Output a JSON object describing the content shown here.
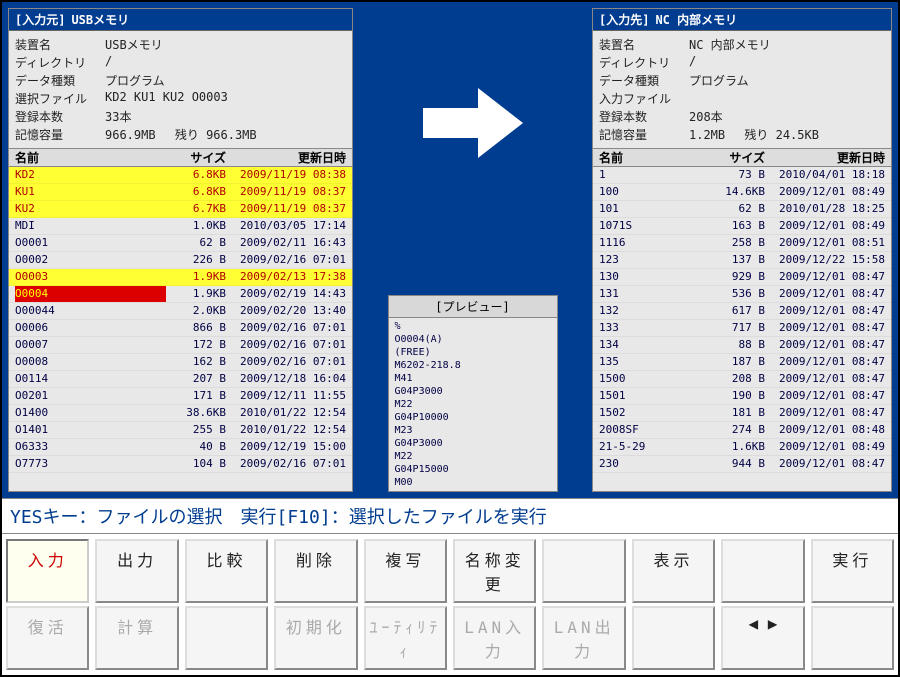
{
  "left": {
    "title_bracket": "[入力元]",
    "title_label": "USBメモリ",
    "meta": {
      "device_key": "装置名",
      "device_val": "USBメモリ",
      "dir_key": "ディレクトリ",
      "dir_val": "/",
      "type_key": "データ種類",
      "type_val": "プログラム",
      "selfile_key": "選択ファイル",
      "selfile_val": "KD2 KU1 KU2 O0003",
      "count_key": "登録本数",
      "count_val": "33本",
      "cap_key": "記憶容量",
      "cap_val": "966.9MB",
      "rem_key": "残り",
      "rem_val": "966.3MB"
    },
    "cols": {
      "name": "名前",
      "size": "サイズ",
      "date": "更新日時"
    },
    "rows": [
      {
        "name": "KD2",
        "size": "6.8KB",
        "date": "2009/11/19 08:38",
        "sel": "y"
      },
      {
        "name": "KU1",
        "size": "6.8KB",
        "date": "2009/11/19 08:37",
        "sel": "y"
      },
      {
        "name": "KU2",
        "size": "6.7KB",
        "date": "2009/11/19 08:37",
        "sel": "y"
      },
      {
        "name": "MDI",
        "size": "1.0KB",
        "date": "2010/03/05 17:14",
        "sel": ""
      },
      {
        "name": "O0001",
        "size": "62 B",
        "date": "2009/02/11 16:43",
        "sel": ""
      },
      {
        "name": "O0002",
        "size": "226 B",
        "date": "2009/02/16 07:01",
        "sel": ""
      },
      {
        "name": "O0003",
        "size": "1.9KB",
        "date": "2009/02/13 17:38",
        "sel": "y"
      },
      {
        "name": "O0004",
        "size": "1.9KB",
        "date": "2009/02/19 14:43",
        "sel": "r"
      },
      {
        "name": "O00044",
        "size": "2.0KB",
        "date": "2009/02/20 13:40",
        "sel": ""
      },
      {
        "name": "O0006",
        "size": "866 B",
        "date": "2009/02/16 07:01",
        "sel": ""
      },
      {
        "name": "O0007",
        "size": "172 B",
        "date": "2009/02/16 07:01",
        "sel": ""
      },
      {
        "name": "O0008",
        "size": "162 B",
        "date": "2009/02/16 07:01",
        "sel": ""
      },
      {
        "name": "O0114",
        "size": "207 B",
        "date": "2009/12/18 16:04",
        "sel": ""
      },
      {
        "name": "O0201",
        "size": "171 B",
        "date": "2009/12/11 11:55",
        "sel": ""
      },
      {
        "name": "O1400",
        "size": "38.6KB",
        "date": "2010/01/22 12:54",
        "sel": ""
      },
      {
        "name": "O1401",
        "size": "255 B",
        "date": "2010/01/22 12:54",
        "sel": ""
      },
      {
        "name": "O6333",
        "size": "40 B",
        "date": "2009/12/19 15:00",
        "sel": ""
      },
      {
        "name": "O7773",
        "size": "104 B",
        "date": "2009/02/16 07:01",
        "sel": ""
      }
    ]
  },
  "preview": {
    "title": "[プレビュー]",
    "lines": [
      "%",
      "O0004(A)",
      "(FREE)",
      "M6202-218.8",
      "M41",
      "G04P3000",
      "M22",
      "G04P10000",
      "M23",
      "G04P3000",
      "M22",
      "G04P15000",
      "M00"
    ]
  },
  "right": {
    "title_bracket": "[入力先]",
    "title_label": "NC 内部メモリ",
    "meta": {
      "device_key": "装置名",
      "device_val": "NC 内部メモリ",
      "dir_key": "ディレクトリ",
      "dir_val": "/",
      "type_key": "データ種類",
      "type_val": "プログラム",
      "infile_key": "入力ファイル",
      "infile_val": "",
      "count_key": "登録本数",
      "count_val": "208本",
      "cap_key": "記憶容量",
      "cap_val": "1.2MB",
      "rem_key": "残り",
      "rem_val": "24.5KB"
    },
    "cols": {
      "name": "名前",
      "size": "サイズ",
      "date": "更新日時"
    },
    "rows": [
      {
        "name": "1",
        "size": "73 B",
        "date": "2010/04/01 18:18"
      },
      {
        "name": "100",
        "size": "14.6KB",
        "date": "2009/12/01 08:49"
      },
      {
        "name": "101",
        "size": "62 B",
        "date": "2010/01/28 18:25"
      },
      {
        "name": "1071S",
        "size": "163 B",
        "date": "2009/12/01 08:49"
      },
      {
        "name": "1116",
        "size": "258 B",
        "date": "2009/12/01 08:51"
      },
      {
        "name": "123",
        "size": "137 B",
        "date": "2009/12/22 15:58"
      },
      {
        "name": "130",
        "size": "929 B",
        "date": "2009/12/01 08:47"
      },
      {
        "name": "131",
        "size": "536 B",
        "date": "2009/12/01 08:47"
      },
      {
        "name": "132",
        "size": "617 B",
        "date": "2009/12/01 08:47"
      },
      {
        "name": "133",
        "size": "717 B",
        "date": "2009/12/01 08:47"
      },
      {
        "name": "134",
        "size": "88 B",
        "date": "2009/12/01 08:47"
      },
      {
        "name": "135",
        "size": "187 B",
        "date": "2009/12/01 08:47"
      },
      {
        "name": "1500",
        "size": "208 B",
        "date": "2009/12/01 08:47"
      },
      {
        "name": "1501",
        "size": "190 B",
        "date": "2009/12/01 08:47"
      },
      {
        "name": "1502",
        "size": "181 B",
        "date": "2009/12/01 08:47"
      },
      {
        "name": "2008SF",
        "size": "274 B",
        "date": "2009/12/01 08:48"
      },
      {
        "name": "21-5-29",
        "size": "1.6KB",
        "date": "2009/12/01 08:49"
      },
      {
        "name": "230",
        "size": "944 B",
        "date": "2009/12/01 08:47"
      }
    ]
  },
  "msgbar": "YESキー：ファイルの選択　実行[F10]：選択したファイルを実行",
  "fkeys": {
    "row1": [
      "入力",
      "出力",
      "比較",
      "削除",
      "複写",
      "名称変更",
      "",
      "表示",
      "",
      "実行"
    ],
    "row2": [
      "復活",
      "計算",
      "",
      "初期化",
      "ﾕｰﾃｨﾘﾃｨ",
      "LAN入力",
      "LAN出力",
      "",
      "◀ ▶",
      ""
    ],
    "active": "入力",
    "disabled_row2": [
      "復活",
      "計算",
      "初期化",
      "ﾕｰﾃｨﾘﾃｨ",
      "LAN入力",
      "LAN出力"
    ]
  }
}
